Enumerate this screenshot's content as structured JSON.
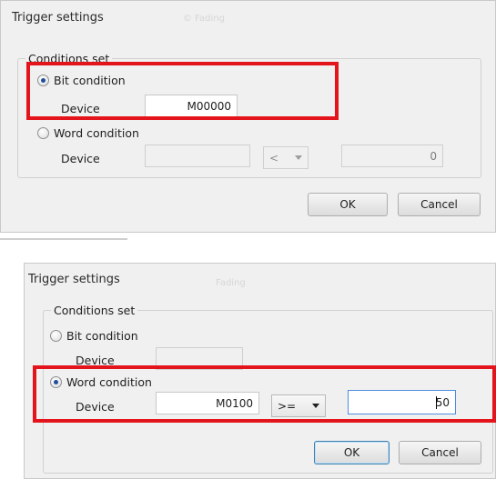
{
  "colors": {
    "highlight": "#e3141b",
    "dialog_bg": "#f0f0f0"
  },
  "dialog1": {
    "title": "Trigger settings",
    "ghost_text": "© Fading",
    "group_title": "Conditions set",
    "bit_option": {
      "label": "Bit condition",
      "checked": true
    },
    "bit_device_label": "Device",
    "bit_device_value": "M00000",
    "word_option": {
      "label": "Word condition",
      "checked": false
    },
    "word_device_label": "Device",
    "word_device_value": "",
    "operator": "<",
    "word_value": "0",
    "ok": "OK",
    "cancel": "Cancel"
  },
  "dialog2": {
    "title": "Trigger settings",
    "ghost_text": "Fading",
    "group_title": "Conditions set",
    "bit_option": {
      "label": "Bit condition",
      "checked": false
    },
    "bit_device_label": "Device",
    "bit_device_value": "",
    "word_option": {
      "label": "Word condition",
      "checked": true
    },
    "word_device_label": "Device",
    "word_device_value": "M0100",
    "operator": ">=",
    "word_value": "50",
    "ok": "OK",
    "cancel": "Cancel"
  }
}
